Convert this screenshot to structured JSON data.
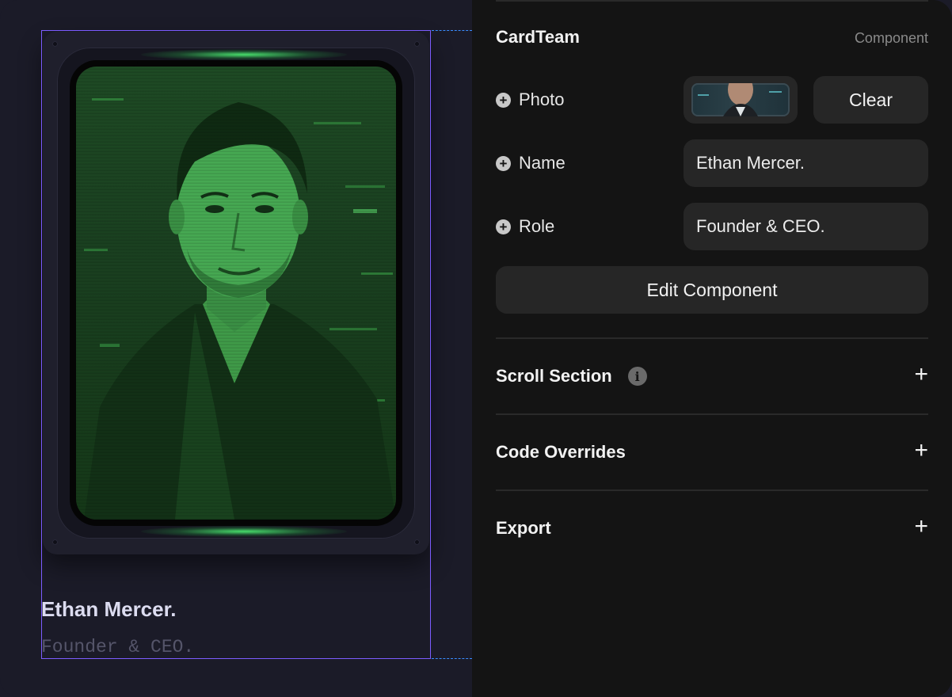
{
  "canvas": {
    "card": {
      "name": "Ethan Mercer.",
      "role": "Founder & CEO."
    },
    "selection_color": "#7c5cff",
    "guide_color": "#3a8cff",
    "screen_tint": "#1e4a24"
  },
  "panel": {
    "title": "CardTeam",
    "type_label": "Component",
    "properties": {
      "photo": {
        "label": "Photo",
        "clear_label": "Clear"
      },
      "name": {
        "label": "Name",
        "value": "Ethan Mercer."
      },
      "role": {
        "label": "Role",
        "value": "Founder & CEO."
      }
    },
    "edit_button": "Edit Component",
    "sections": [
      {
        "label": "Scroll Section",
        "has_info": true
      },
      {
        "label": "Code Overrides",
        "has_info": false
      },
      {
        "label": "Export",
        "has_info": false
      }
    ],
    "icons": {
      "add": "plus-circle-icon",
      "info": "info-icon",
      "expand": "plus-icon"
    }
  }
}
